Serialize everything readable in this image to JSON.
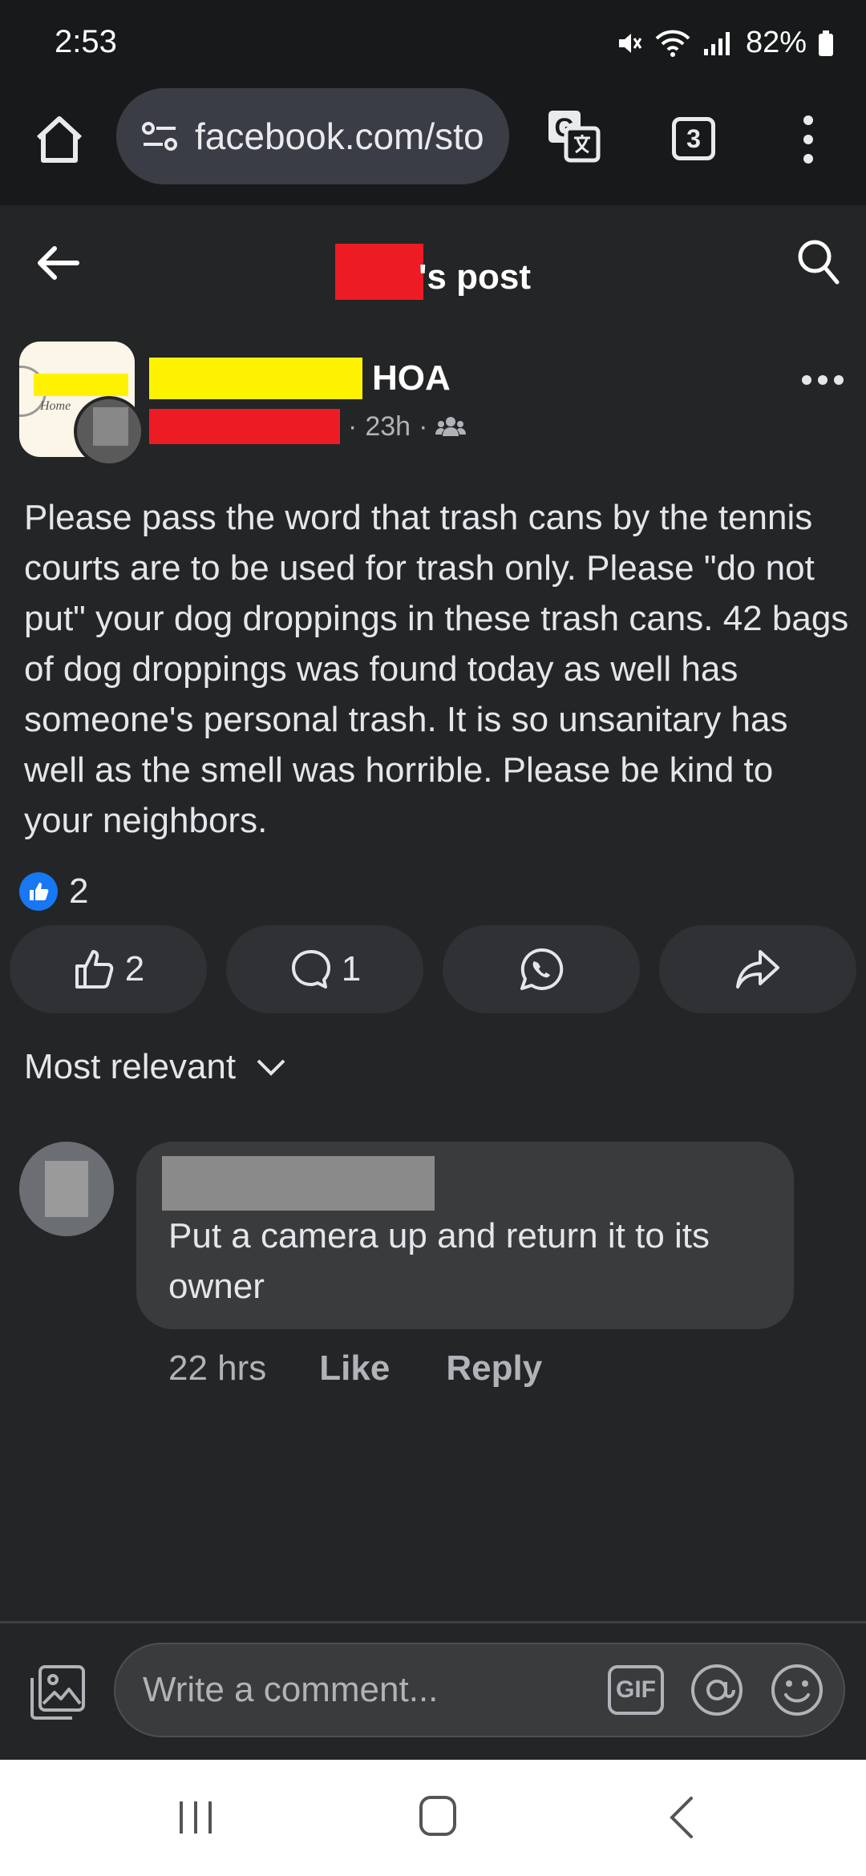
{
  "status_bar": {
    "time": "2:53",
    "battery": "82%"
  },
  "browser": {
    "url": "facebook.com/sto",
    "tab_count": "3"
  },
  "header": {
    "title_suffix": "'s post"
  },
  "post": {
    "author_suffix": "HOA",
    "time": "23h",
    "audience_icon": "group-icon",
    "body": "Please pass the word that trash cans by the tennis courts are to be used for trash only. Please \"do not put\" your dog droppings in these trash cans. 42 bags of dog droppings was found today as well has someone's personal trash. It is so unsanitary has well as the smell was horrible. Please be kind to your neighbors.",
    "reaction_count": "2",
    "actions": {
      "like_count": "2",
      "comment_count": "1"
    }
  },
  "comments": {
    "sort_label": "Most relevant",
    "items": [
      {
        "text": "Put a camera up and return it to its owner",
        "time": "22 hrs",
        "like_label": "Like",
        "reply_label": "Reply"
      }
    ]
  },
  "composer": {
    "placeholder": "Write a comment...",
    "gif_label": "GIF"
  },
  "colors": {
    "background": "#242526",
    "bar": "#18191a",
    "accent": "#1877f2",
    "redaction_red": "#ed1c24",
    "redaction_yellow": "#fff200"
  }
}
